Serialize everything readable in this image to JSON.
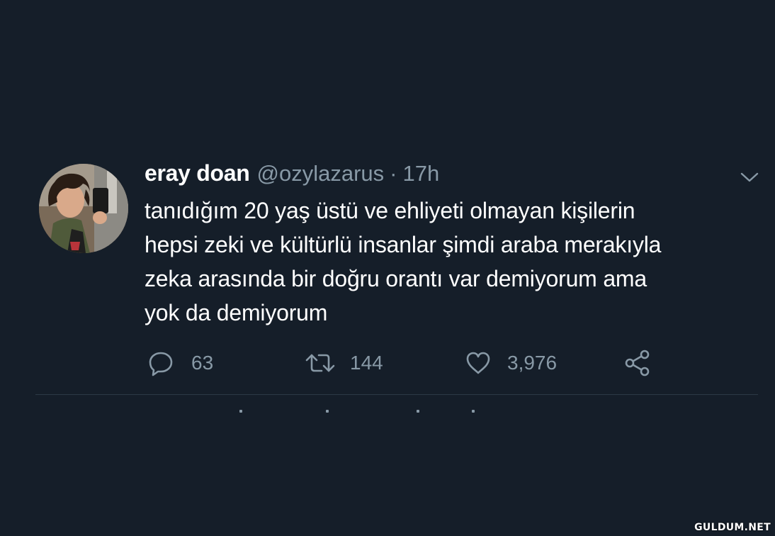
{
  "tweet": {
    "display_name": "eray doan",
    "handle": "@ozylazarus",
    "separator": "·",
    "time": "17h",
    "text_lines": [
      "tanıdığım 20 yaş üstü ve ehliyeti olmayan kişilerin",
      "hepsi zeki ve kültürlü insanlar şimdi araba merakıyla",
      "zeka arasında bir doğru orantı var demiyorum ama",
      "yok da demiyorum"
    ],
    "actions": {
      "reply": {
        "icon": "reply-icon",
        "count": "63"
      },
      "retweet": {
        "icon": "retweet-icon",
        "count": "144"
      },
      "like": {
        "icon": "heart-icon",
        "count": "3,976"
      },
      "share": {
        "icon": "share-icon"
      }
    },
    "menu_icon": "chevron-down-icon"
  },
  "watermark": "GULDUM.NET",
  "colors": {
    "background": "#151e29",
    "text": "#ffffff",
    "secondary": "#8899a6",
    "divider": "#2c3946"
  }
}
